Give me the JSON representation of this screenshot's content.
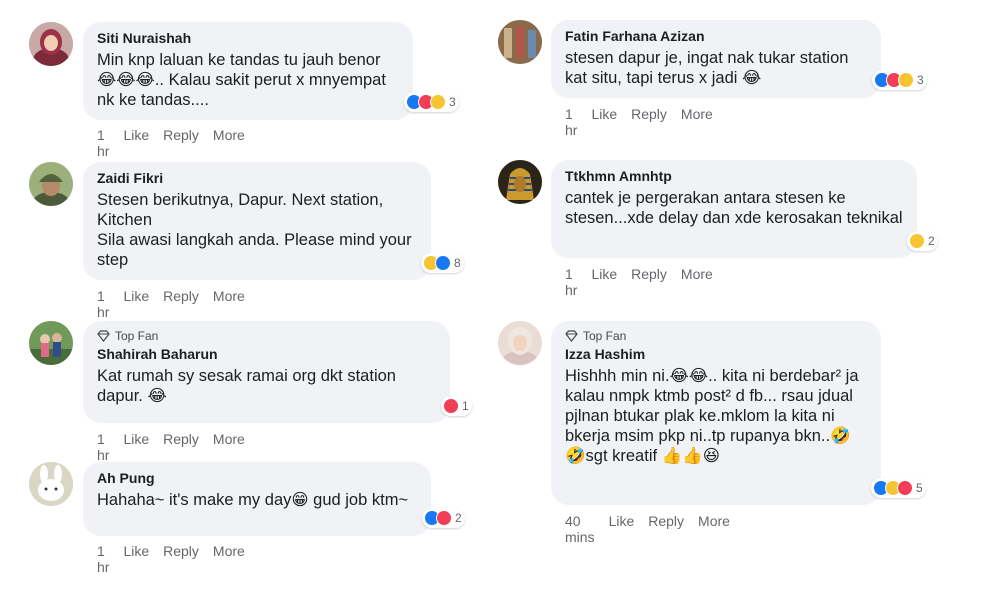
{
  "comments": [
    {
      "author": "Siti Nuraishah",
      "top_fan": "",
      "text": "Min knp laluan ke tandas tu jauh benor 😂😂😂.. Kalau sakit perut x mnyempat nk ke tandas....",
      "reaction_count": "3",
      "time": "1 hr",
      "avatar_icon": "person-hijab-avatar"
    },
    {
      "author": "Zaidi Fikri",
      "top_fan": "",
      "text": "Stesen berikutnya, Dapur. Next station, Kitchen\nSila awasi langkah anda. Please mind your step",
      "reaction_count": "8",
      "time": "1 hr",
      "avatar_icon": "soldier-helmet-avatar"
    },
    {
      "author": "Shahirah Baharun",
      "top_fan": "Top Fan",
      "text": "Kat rumah sy sesak ramai org dkt station dapur. 😂",
      "reaction_count": "1",
      "time": "1 hr",
      "avatar_icon": "outdoor-couple-avatar"
    },
    {
      "author": "Ah Pung",
      "top_fan": "",
      "text": "Hahaha~ it's make my day😁 gud job ktm~",
      "reaction_count": "2",
      "time": "1 hr",
      "avatar_icon": "cartoon-bunny-avatar"
    },
    {
      "author": "Fatin Farhana Azizan",
      "top_fan": "",
      "text": "stesen dapur je, ingat nak tukar station kat situ, tapi terus x jadi 😂",
      "reaction_count": "3",
      "time": "1 hr",
      "avatar_icon": "building-photo-avatar"
    },
    {
      "author": "Ttkhmn Amnhtp",
      "top_fan": "",
      "text": "cantek je pergerakan antara stesen ke stesen...xde delay dan xde kerosakan teknikal",
      "reaction_count": "2",
      "time": "1 hr",
      "avatar_icon": "pharaoh-mask-avatar"
    },
    {
      "author": "Izza Hashim",
      "top_fan": "Top Fan",
      "text": "Hishhh min ni.😂😂.. kita ni berdebar² ja kalau nmpk ktmb post² d fb... rsau jdual pjlnan btukar plak ke.mklom la kita ni bkerja msim pkp ni..tp rupanya bkn..🤣🤣sgt kreatif 👍👍😆",
      "reaction_count": "5",
      "time": "40 mins",
      "avatar_icon": "woman-selfie-avatar"
    }
  ],
  "actions": {
    "like": "Like",
    "reply": "Reply",
    "more": "More"
  },
  "colors": {
    "bubble": "#f0f2f5",
    "like": "#1877f2",
    "love": "#f33e58",
    "haha": "#f7c531",
    "muted": "#65676b"
  }
}
